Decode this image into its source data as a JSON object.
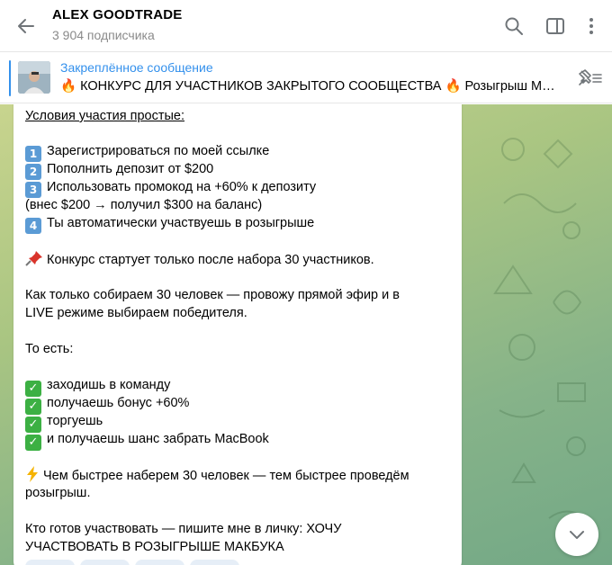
{
  "header": {
    "channel_name": "ALEX GOODTRADE",
    "subscribers": "3 904 подписчика",
    "icons": [
      "back-arrow-icon",
      "search-icon",
      "sidebar-toggle-icon",
      "more-vertical-icon"
    ]
  },
  "pinned": {
    "title": "Закреплённое сообщение",
    "text": "🔥 КОНКУРС ДЛЯ  УЧАСТНИКОВ ЗАКРЫТОГО СООБЩЕСТВА 🔥  Розыгрыш MacBook",
    "icons": [
      "unpin-icon"
    ]
  },
  "message": {
    "conditions_title": "Условия участия простые:",
    "steps": [
      {
        "num": "1",
        "text": "Зарегистрироваться по моей ссылке"
      },
      {
        "num": "2",
        "text": "Пополнить депозит от $200"
      },
      {
        "num": "3",
        "text": "Использовать промокод на +60% к депозиту"
      },
      {
        "num": "",
        "text": "(внес $200 → получил $300 на баланс)"
      },
      {
        "num": "4",
        "text": "Ты автоматически участвуешь в розыгрыше"
      }
    ],
    "start_note": "Конкурс стартует только после набора 30 участников.",
    "live_line1": "Как только собираем 30 человек — провожу прямой эфир и в",
    "live_line2": "LIVE режиме выбираем победителя.",
    "that_is": "То есть:",
    "checks": [
      "заходишь в команду",
      "получаешь бонус +60%",
      "торгуешь",
      "и получаешь шанс забрать MacBook"
    ],
    "faster_line1": "Чем быстрее наберем 30 человек — тем быстрее проведём",
    "faster_line2": "розыгрыш.",
    "cta_line1": "Кто готов участвовать — пишите мне в личку: ХОЧУ",
    "cta_line2": "УЧАСТВОВАТЬ В РОЗЫГРЫШЕ МАКБУКА"
  },
  "colors": {
    "accent": "#3390ec",
    "keycap": "#5b9bd5",
    "check": "#3cb043"
  }
}
